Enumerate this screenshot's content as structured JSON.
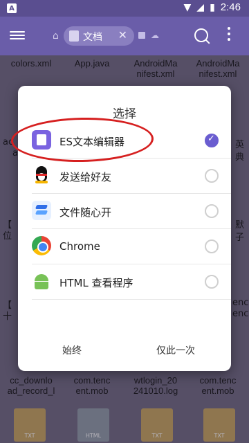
{
  "status_bar": {
    "time": "2:46",
    "notif_letter": "A"
  },
  "app_bar": {
    "tab_label": "文档"
  },
  "background_files": {
    "row1": [
      "colors.xml",
      "App.java",
      "AndroidMa\nnifest.xml",
      "AndroidMa\nnifest.xml"
    ],
    "row_bottom": [
      "cc_downlo\nad_record_l",
      "com.tenc\nent.mob",
      "wtlogin_20\n241010.log",
      "com.tenc\nent.mob"
    ],
    "tiles": [
      "TXT",
      "HTML",
      "TXT",
      "TXT"
    ],
    "partials": [
      "ac",
      "a",
      "英",
      "典",
      "【",
      "位",
      "默",
      "子",
      "【",
      "十",
      "enc",
      "enc"
    ]
  },
  "dialog": {
    "title": "选择",
    "options": [
      {
        "label": "ES文本编辑器",
        "icon": "es-text-editor-icon",
        "checked": true
      },
      {
        "label": "发送给好友",
        "icon": "qq-penguin-icon",
        "checked": false
      },
      {
        "label": "文件随心开",
        "icon": "stacked-layers-icon",
        "checked": false
      },
      {
        "label": "Chrome",
        "icon": "chrome-icon",
        "checked": false
      },
      {
        "label": "HTML 查看程序",
        "icon": "android-icon",
        "checked": false
      }
    ],
    "always_label": "始终",
    "once_label": "仅此一次"
  },
  "colors": {
    "accent": "#6a5dd0",
    "app_bar": "#6a5da9",
    "annotation": "#d62020"
  }
}
